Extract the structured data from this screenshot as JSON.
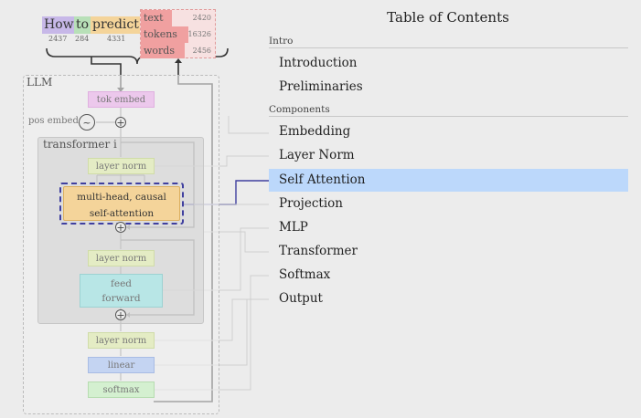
{
  "tokens": [
    {
      "word": "How",
      "id": "2437",
      "color": "#c7b8e8"
    },
    {
      "word": "to",
      "id": "284",
      "color": "#b8e0b8"
    },
    {
      "word": "predict",
      "id": "4331",
      "color": "#f4d49a"
    }
  ],
  "output_box": {
    "rows": [
      {
        "label": "text",
        "value": "2420"
      },
      {
        "label": "tokens",
        "value": "16326"
      },
      {
        "label": "words",
        "value": "2456"
      }
    ]
  },
  "diagram": {
    "llm_label": "LLM",
    "tok_embed": "tok embed",
    "pos_embed": "pos embed",
    "pos_symbol": "~",
    "transformer_label": "transformer i",
    "layer_norm_1": "layer norm",
    "attention_line1": "multi-head, causal",
    "attention_line2": "self-attention",
    "layer_norm_2": "layer norm",
    "ffn_line1": "feed",
    "ffn_line2": "forward",
    "layer_norm_3": "layer norm",
    "linear": "linear",
    "softmax": "softmax"
  },
  "toc": {
    "title": "Table of Contents",
    "sections": [
      {
        "label": "Intro",
        "items": [
          "Introduction",
          "Preliminaries"
        ]
      },
      {
        "label": "Components",
        "items": [
          "Embedding",
          "Layer Norm",
          "Self Attention",
          "Projection",
          "MLP",
          "Transformer",
          "Softmax",
          "Output"
        ]
      }
    ],
    "active_item": "Self Attention"
  },
  "colors": {
    "highlight": "#bcd8fb",
    "attention_fill": "#f4d49a",
    "attention_border": "#3f3f9f",
    "tok_embed_fill": "#ecc8ec",
    "layer_norm_fill": "#e4ecc4",
    "ffn_fill": "#b8e6e6",
    "linear_fill": "#c4d4f2",
    "softmax_fill": "#d4f0d0",
    "output_fill": "#f0a0a0"
  }
}
